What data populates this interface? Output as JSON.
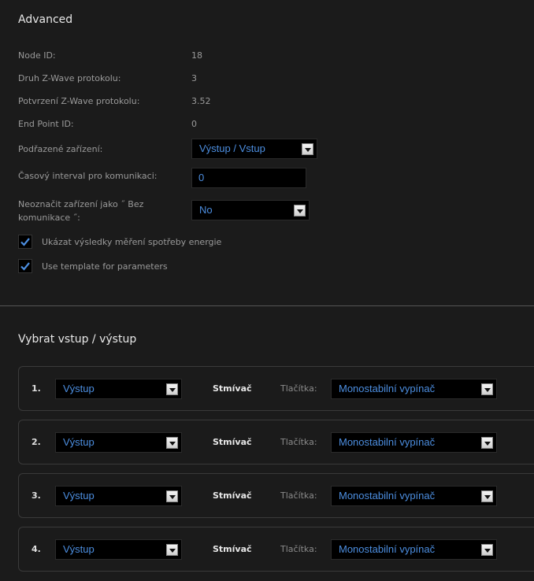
{
  "advanced": {
    "title": "Advanced",
    "node_id_label": "Node ID:",
    "node_id_value": "18",
    "protocol_type_label": "Druh Z-Wave protokolu:",
    "protocol_type_value": "3",
    "protocol_ver_label": "Potvrzení Z-Wave protokolu:",
    "protocol_ver_value": "3.52",
    "endpoint_label": "End Point ID:",
    "endpoint_value": "0",
    "subdevice_label": "Podřazené zařízení:",
    "subdevice_value": "Výstup / Vstup",
    "interval_label": "Časový interval pro komunikaci:",
    "interval_value": "0",
    "no_comm_label": "Neoznačit zařízení jako ˝ Bez komunikace ˝:",
    "no_comm_value": "No",
    "energy_label": "Ukázat výsledky měření spotřeby energie",
    "template_label": "Use template for parameters"
  },
  "io": {
    "title": "Vybrat vstup / výstup",
    "rows": [
      {
        "num": "1.",
        "io": "Výstup",
        "type": "Stmívač",
        "btn_label": "Tlačítka:",
        "btn_value": "Monostabilní vypínač"
      },
      {
        "num": "2.",
        "io": "Výstup",
        "type": "Stmívač",
        "btn_label": "Tlačítka:",
        "btn_value": "Monostabilní vypínač"
      },
      {
        "num": "3.",
        "io": "Výstup",
        "type": "Stmívač",
        "btn_label": "Tlačítka:",
        "btn_value": "Monostabilní vypínač"
      },
      {
        "num": "4.",
        "io": "Výstup",
        "type": "Stmívač",
        "btn_label": "Tlačítka:",
        "btn_value": "Monostabilní vypínač"
      }
    ]
  },
  "colors": {
    "background": "#1b1b1b",
    "accent": "#4c8ee0",
    "check": "#4c8ee0"
  }
}
